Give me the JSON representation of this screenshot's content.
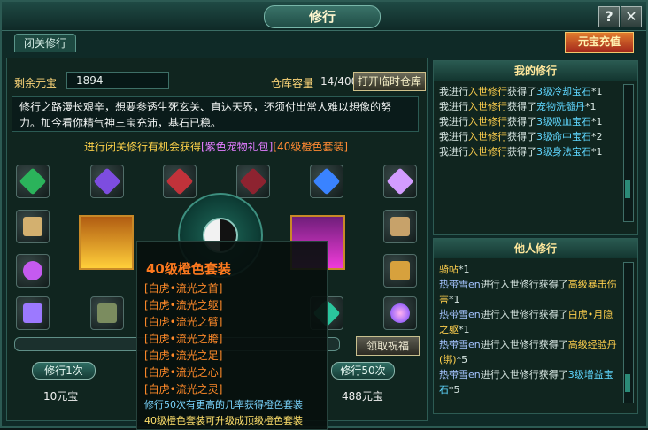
{
  "window": {
    "title": "修行",
    "help_label": "?",
    "close_label": "✕"
  },
  "tab": {
    "label": "闭关修行"
  },
  "recharge": {
    "label": "元宝充值"
  },
  "ingot": {
    "label": "剩余元宝",
    "value": "1894"
  },
  "storage": {
    "label": "仓库容量",
    "value": "14/400",
    "button": "打开临时仓库"
  },
  "story": {
    "text": "修行之路漫长艰辛，想要参透生死玄关、直达天界，还须付出常人难以想像的努力。加今看你精气神三宝充沛，基石已稳。"
  },
  "banner": {
    "prefix": "进行闭关修行有机会获得",
    "purple": "[紫色宠物礼包]",
    "orange": "[40级橙色套装]"
  },
  "tooltip": {
    "title": "40级橙色套装",
    "items": [
      "[白虎•流光之首]",
      "[白虎•流光之躯]",
      "[白虎•流光之臂]",
      "[白虎•流光之胯]",
      "[白虎•流光之足]",
      "[白虎•流光之心]",
      "[白虎•流光之灵]"
    ],
    "note1": "修行50次有更高的几率获得橙色套装",
    "note2": "40级橙色套装可升级成顶级橙色套装"
  },
  "actions": {
    "claim": "领取祝福",
    "cultivate1": "修行1次",
    "cultivate50": "修行50次",
    "cost1": "10元宝",
    "cost50": "488元宝"
  },
  "my_log": {
    "title": "我的修行",
    "lines": [
      [
        "我进行",
        "入世修行",
        "获得了",
        "3级冷却宝石",
        "*1"
      ],
      [
        "我进行",
        "入世修行",
        "获得了",
        "宠物洗髓丹",
        "*1"
      ],
      [
        "我进行",
        "入世修行",
        "获得了",
        "3级吸血宝石",
        "*1"
      ],
      [
        "我进行",
        "入世修行",
        "获得了",
        "3级命中宝石",
        "*2"
      ],
      [
        "我进行",
        "入世修行",
        "获得了",
        "3级身法宝石",
        "*1"
      ]
    ]
  },
  "other_log": {
    "title": "他人修行",
    "lines": [
      [
        "骑帖",
        "",
        "",
        "",
        "*1"
      ],
      [
        "热带雪en",
        "进行入世修行",
        "获得了",
        "高级暴击伤害",
        "*1"
      ],
      [
        "热带雪en",
        "进行入世修行",
        "获得了",
        "白虎•月隐之躯",
        "*1"
      ],
      [
        "热带雪en",
        "进行入世修行",
        "获得了",
        "高级经验丹(绑)",
        "*5"
      ],
      [
        "热带雪en",
        "进行入世修行",
        "获得了",
        "3级增益宝石",
        "*5"
      ]
    ]
  }
}
